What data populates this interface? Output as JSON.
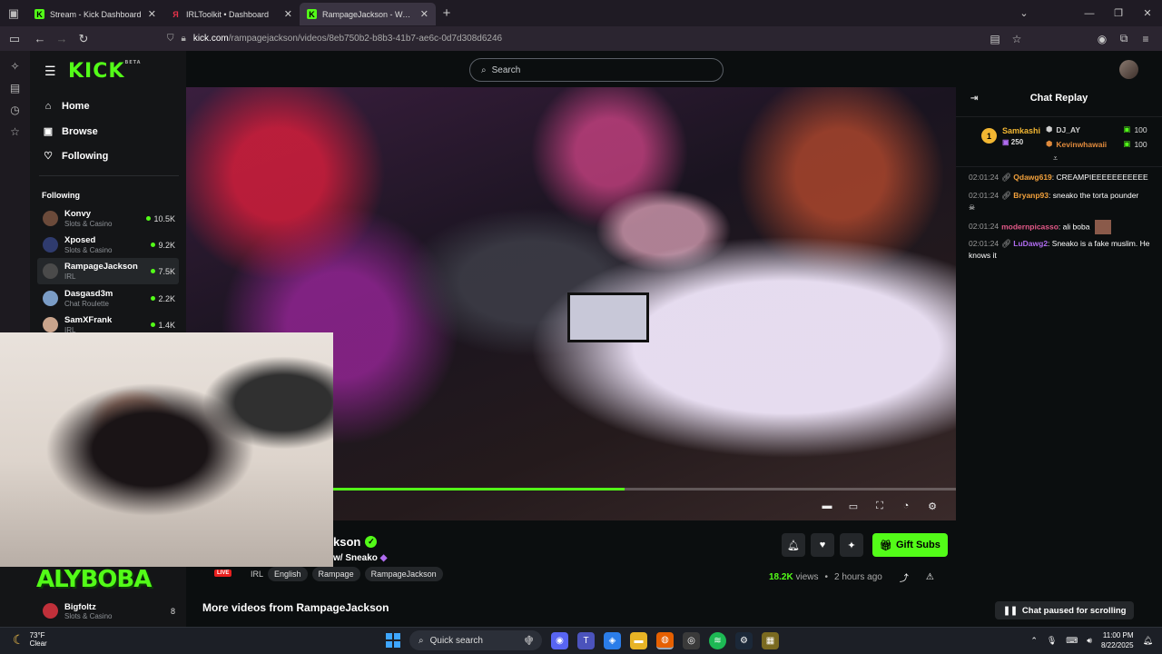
{
  "browser": {
    "tabs": [
      {
        "label": "Stream - Kick Dashboard",
        "active": false,
        "favicon": "K",
        "favcolor": "#53fc18"
      },
      {
        "label": "IRLToolkit • Dashboard",
        "active": false,
        "favicon": "Я",
        "favcolor": "#e8334a"
      },
      {
        "label": "RampageJackson - Watch the V",
        "active": true,
        "favicon": "K",
        "favcolor": "#53fc18"
      }
    ],
    "url_host": "kick.com",
    "url_path": "/rampagejackson/videos/8eb750b2-b8b3-41b7-ae6c-0d7d308d6246"
  },
  "kick": {
    "logo": "KICK",
    "logo_badge": "BETA",
    "search_placeholder": "Search",
    "nav": [
      {
        "label": "Home",
        "icon": "home-icon"
      },
      {
        "label": "Browse",
        "icon": "browse-icon"
      },
      {
        "label": "Following",
        "icon": "heart-icon"
      }
    ],
    "following_title": "Following",
    "channels": [
      {
        "name": "Konvy",
        "category": "Slots & Casino",
        "viewers": "10.5K",
        "color": "#6b4a3a"
      },
      {
        "name": "Xposed",
        "category": "Slots & Casino",
        "viewers": "9.2K",
        "color": "#2f3b6e"
      },
      {
        "name": "RampageJackson",
        "category": "IRL",
        "viewers": "7.5K",
        "color": "#4a4a4a"
      },
      {
        "name": "Dasgasd3m",
        "category": "Chat Roulette",
        "viewers": "2.2K",
        "color": "#7a9cc6"
      },
      {
        "name": "SamXFrank",
        "category": "IRL",
        "viewers": "1.4K",
        "color": "#c9a48c"
      }
    ],
    "bigfoltz": {
      "name": "Bigfoltz",
      "category": "Slots & Casino",
      "viewers": "8"
    }
  },
  "video": {
    "progress_percent": 0.57,
    "title_fragment": "kson",
    "subtitle_fragment": "w/ Sneako",
    "tags_plain": "IRL",
    "tags": [
      "English",
      "Rampage",
      "RampageJackson"
    ],
    "views": "18.2K",
    "views_label": "views",
    "ago": "2 hours ago",
    "gift_subs": "Gift Subs",
    "more_videos": "More videos from RampageJackson"
  },
  "chat": {
    "title": "Chat Replay",
    "top_gifter": {
      "rank": "1",
      "name": "Samkashi",
      "count": "250"
    },
    "gifters": [
      {
        "name": "DJ_AY",
        "count": "100",
        "color": "#cfcfcf"
      },
      {
        "name": "Kevinwhawaii",
        "count": "100",
        "color": "#e08a3c"
      }
    ],
    "messages": [
      {
        "time": "02:01:24",
        "user": "Qdawg619",
        "ucolor": "#f2a13c",
        "text": ": CREAMPIEEEEEEEEEEE"
      },
      {
        "time": "02:01:24",
        "user": "Bryanp93",
        "ucolor": "#f2a13c",
        "text": ": sneako the torta pounder"
      },
      {
        "time": "02:01:24",
        "user": "modernpicasso",
        "ucolor": "#e65a8a",
        "text": ": ali boba"
      },
      {
        "time": "02:01:24",
        "user": "LuDawg2",
        "ucolor": "#b06cf0",
        "text": ": Sneako is a fake muslim. He knows it"
      }
    ],
    "paused": "Chat paused for scrolling"
  },
  "overlay": {
    "brand": "ALYBOBA",
    "live": "LIVE"
  },
  "taskbar": {
    "temp": "73°F",
    "condition": "Clear",
    "search": "Quick search",
    "time": "11:00 PM",
    "date": "8/22/2025"
  }
}
